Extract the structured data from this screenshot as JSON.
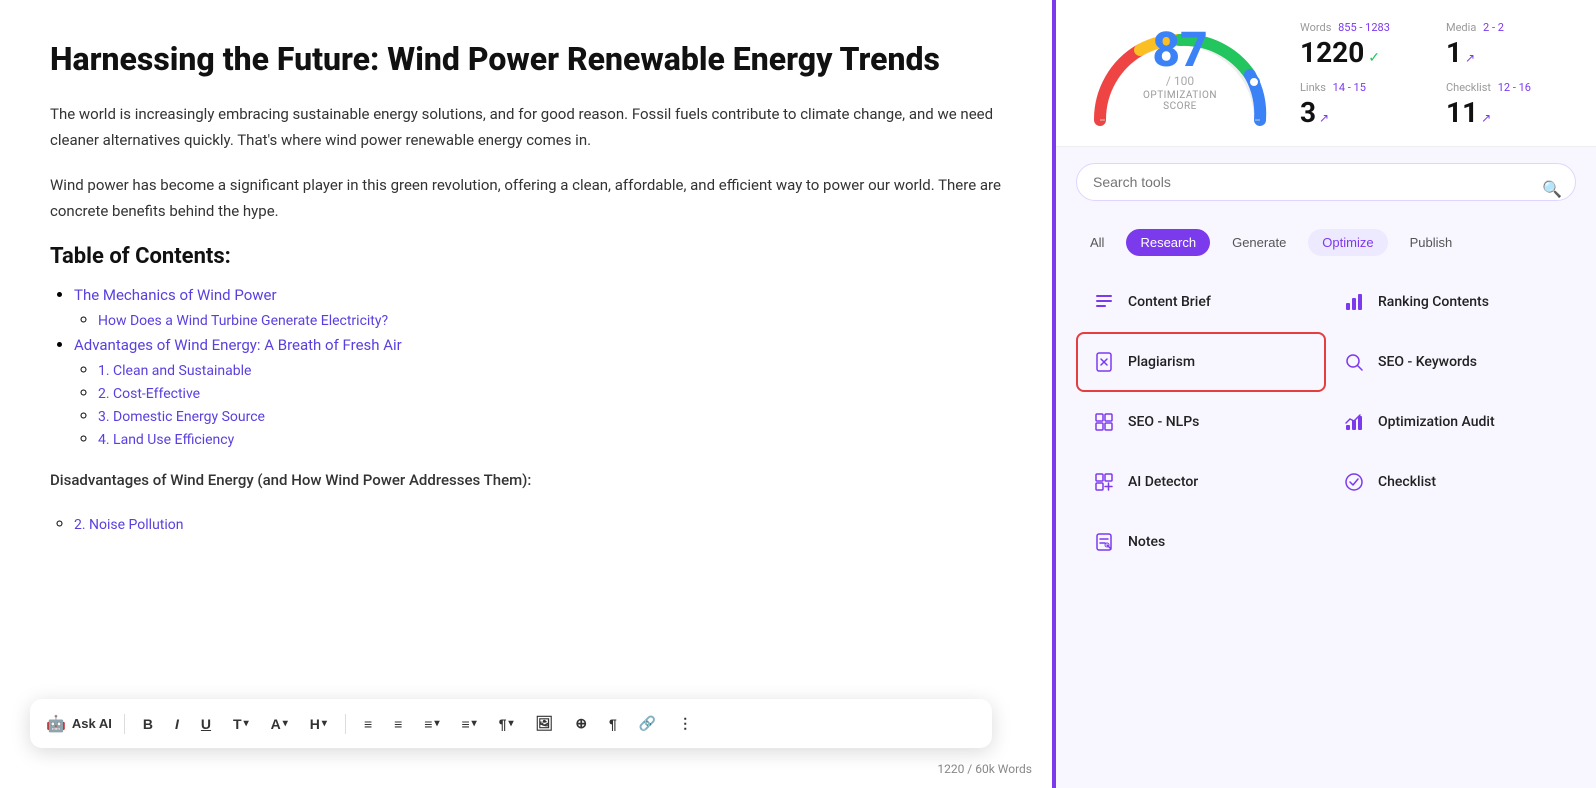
{
  "editor": {
    "title": "Harnessing the Future: Wind Power Renewable Energy Trends",
    "paragraphs": [
      "The world is increasingly embracing sustainable energy solutions, and for good reason. Fossil fuels contribute to climate change, and we need cleaner alternatives quickly. That's where wind power renewable energy comes in.",
      "Wind power has become a significant player in this green revolution, offering a clean, affordable, and efficient way to power our world. There are concrete benefits behind the hype."
    ],
    "toc_heading": "Table of Contents:",
    "toc": [
      {
        "text": "The Mechanics of Wind Power",
        "sub": [
          "How Does a Wind Turbine Generate Electricity?"
        ]
      },
      {
        "text": "Advantages of Wind Energy: A Breath of Fresh Air",
        "sub": [
          "1. Clean and Sustainable",
          "2. Cost-Effective",
          "3. Domestic Energy Source",
          "4. Land Use Efficiency"
        ]
      }
    ],
    "toc_extra": "Disadvantages of Wind Energy (and How Wind Power Addresses Them):",
    "toc_noise": "2. Noise Pollution",
    "word_count_display": "1220 / 60k Words"
  },
  "toolbar": {
    "ask_ai": "Ask AI",
    "buttons": [
      "B",
      "I",
      "U",
      "T",
      "A",
      "H",
      "≡",
      "≡",
      "≡",
      "≡",
      "¶",
      "⊞",
      "⊕",
      "¶",
      "🔗",
      "⋮"
    ]
  },
  "score": {
    "number": "87",
    "sub": "/ 100",
    "label": "OPTIMIZATION SCORE",
    "stats": [
      {
        "label": "Words",
        "range": "855 - 1283",
        "value": "1220",
        "indicator": "check"
      },
      {
        "label": "Media",
        "range": "2 - 2",
        "value": "1",
        "indicator": "arrow"
      },
      {
        "label": "Links",
        "range": "14 - 15",
        "value": "3",
        "indicator": "arrow"
      },
      {
        "label": "Checklist",
        "range": "12 - 16",
        "value": "11",
        "indicator": "arrow"
      }
    ]
  },
  "tools": {
    "search_placeholder": "Search tools",
    "filters": [
      {
        "label": "All",
        "state": "inactive"
      },
      {
        "label": "Research",
        "state": "active-purple"
      },
      {
        "label": "Generate",
        "state": "inactive"
      },
      {
        "label": "Optimize",
        "state": "active-light"
      },
      {
        "label": "Publish",
        "state": "inactive"
      }
    ],
    "items": [
      {
        "name": "Content Brief",
        "icon": "≡",
        "highlighted": false
      },
      {
        "name": "Ranking Contents",
        "icon": "📊",
        "highlighted": false
      },
      {
        "name": "Plagiarism",
        "icon": "✖",
        "highlighted": true
      },
      {
        "name": "SEO - Keywords",
        "icon": "🔍",
        "highlighted": false
      },
      {
        "name": "SEO - NLPs",
        "icon": "⊡",
        "highlighted": false
      },
      {
        "name": "Optimization Audit",
        "icon": "📈",
        "highlighted": false
      },
      {
        "name": "AI Detector",
        "icon": "⊞",
        "highlighted": false
      },
      {
        "name": "Checklist",
        "icon": "✓",
        "highlighted": false
      },
      {
        "name": "Notes",
        "icon": "✏",
        "highlighted": false
      }
    ]
  }
}
